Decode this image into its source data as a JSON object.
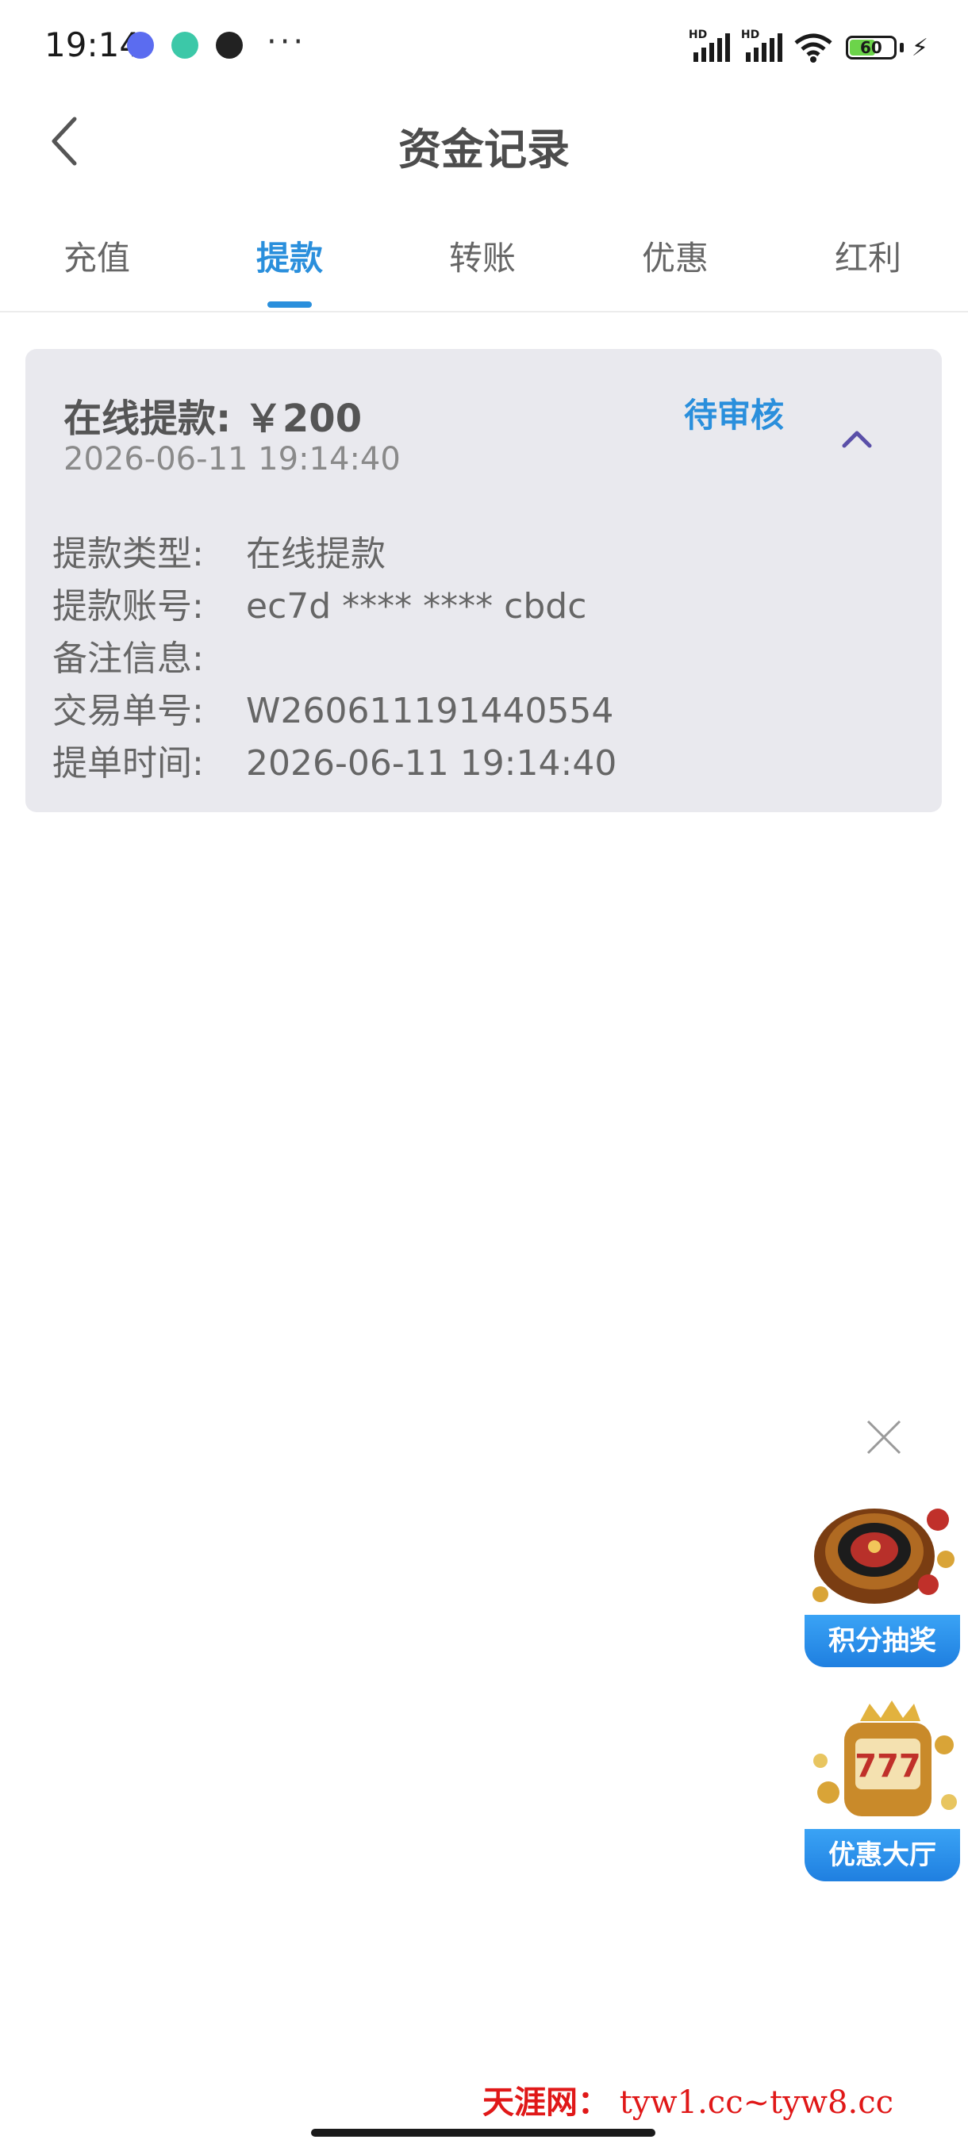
{
  "status_bar": {
    "time": "19:14",
    "app_icons": [
      "tieba-icon",
      "green-app-icon",
      "qq-icon"
    ],
    "more": "···",
    "network_1": "HD",
    "network_2": "HD",
    "battery": "60",
    "battery_level": 0.6
  },
  "header": {
    "title": "资金记录",
    "back_icon": "chevron-left-icon"
  },
  "tabs": [
    {
      "label": "充值",
      "active": false
    },
    {
      "label": "提款",
      "active": true
    },
    {
      "label": "转账",
      "active": false
    },
    {
      "label": "优惠",
      "active": false
    },
    {
      "label": "红利",
      "active": false
    }
  ],
  "record": {
    "title": "在线提款: ￥200",
    "date": "2026-06-11 19:14:40",
    "status": "待审核",
    "status_color": "#2a8fdc",
    "details": [
      {
        "label": "提款类型:",
        "value": "在线提款"
      },
      {
        "label": "提款账号:",
        "value": "ec7d **** **** cbdc"
      },
      {
        "label": "备注信息:",
        "value": ""
      },
      {
        "label": "交易单号:",
        "value": "W260611191440554"
      },
      {
        "label": "提单时间:",
        "value": "2026-06-11 19:14:40"
      }
    ]
  },
  "floating": {
    "close_icon": "close-icon",
    "lottery_label": "积分抽奖",
    "promo_label": "优惠大厅"
  },
  "watermark": {
    "name": "天涯网：",
    "url": "tyw1.cc~tyw8.cc"
  },
  "colors": {
    "accent": "#2a8fdc",
    "card_bg": "#e9e9ee",
    "watermark": "#e01818"
  }
}
